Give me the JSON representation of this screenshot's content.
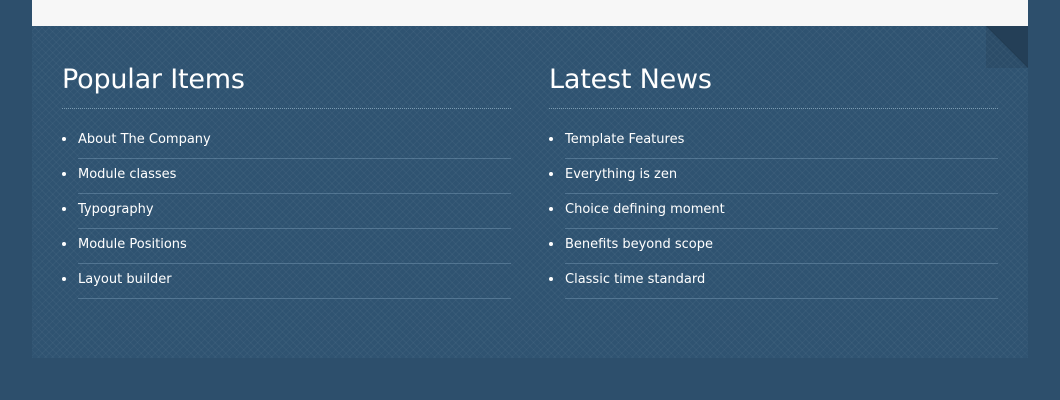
{
  "popular_items": {
    "title": "Popular Items",
    "items": [
      "About The Company",
      "Module classes",
      "Typography",
      "Module Positions",
      "Layout builder"
    ]
  },
  "latest_news": {
    "title": "Latest News",
    "items": [
      "Template Features",
      "Everything is zen",
      "Choice defining moment",
      "Benefits beyond scope",
      "Classic time standard"
    ]
  }
}
